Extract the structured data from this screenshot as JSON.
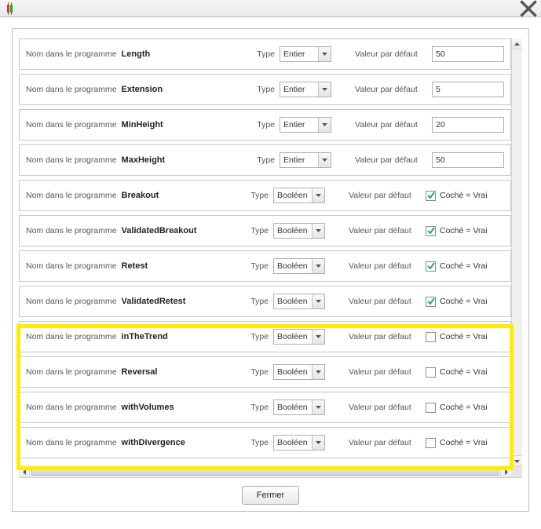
{
  "titlebar": {
    "title": ""
  },
  "labels": {
    "name": "Nom dans le programme",
    "type": "Type",
    "default": "Valeur par défaut",
    "checkbox": "Coché = Vrai"
  },
  "types": {
    "int": "Entier",
    "bool": "Booléen"
  },
  "footer": {
    "close": "Fermer"
  },
  "rows": [
    {
      "name": "Length",
      "type": "int",
      "value": "50"
    },
    {
      "name": "Extension",
      "type": "int",
      "value": "5"
    },
    {
      "name": "MinHeight",
      "type": "int",
      "value": "20"
    },
    {
      "name": "MaxHeight",
      "type": "int",
      "value": "50"
    },
    {
      "name": "Breakout",
      "type": "bool",
      "checked": true
    },
    {
      "name": "ValidatedBreakout",
      "type": "bool",
      "checked": true
    },
    {
      "name": "Retest",
      "type": "bool",
      "checked": true
    },
    {
      "name": "ValidatedRetest",
      "type": "bool",
      "checked": true
    },
    {
      "name": "inTheTrend",
      "type": "bool",
      "checked": false
    },
    {
      "name": "Reversal",
      "type": "bool",
      "checked": false
    },
    {
      "name": "withVolumes",
      "type": "bool",
      "checked": false
    },
    {
      "name": "withDivergence",
      "type": "bool",
      "checked": false
    }
  ],
  "highlight": {
    "fromIndex": 8,
    "toIndex": 11
  }
}
